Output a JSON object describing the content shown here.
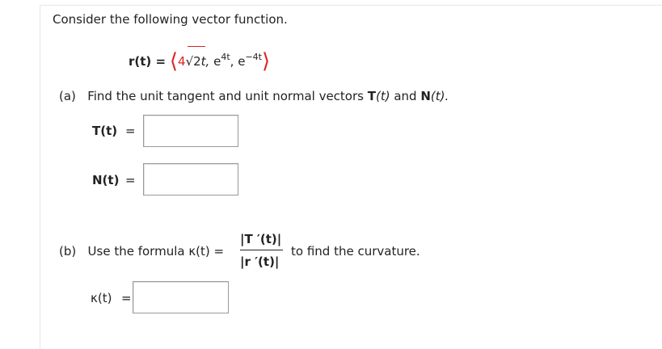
{
  "intro": "Consider the following vector function.",
  "vector_function": {
    "lhs": "r(t) =",
    "coef": "4",
    "radical": "√",
    "radicand": "2",
    "var1": "t,",
    "base2": "e",
    "exp2": "4t",
    "comma2": ",",
    "base3": "e",
    "exp3": "−4t",
    "langle": "⟨",
    "rangle": "⟩"
  },
  "part_a": {
    "label": "(a)",
    "text_pre": "Find the unit tangent and unit normal vectors ",
    "T": "T",
    "t_paren": "(t)",
    "and": " and ",
    "N": "N",
    "t_paren2": "(t).",
    "T_label": "T(t)",
    "N_label": "N(t)",
    "equals": "="
  },
  "part_b": {
    "label": "(b)",
    "text_pre": "Use the formula κ(t) =",
    "numerator": "|T ′(t)|",
    "denominator": "|r ′(t)|",
    "text_post": "to find the curvature.",
    "kappa_label": "κ(t)",
    "equals": "="
  },
  "answers": {
    "T_value": "",
    "N_value": "",
    "kappa_value": ""
  }
}
